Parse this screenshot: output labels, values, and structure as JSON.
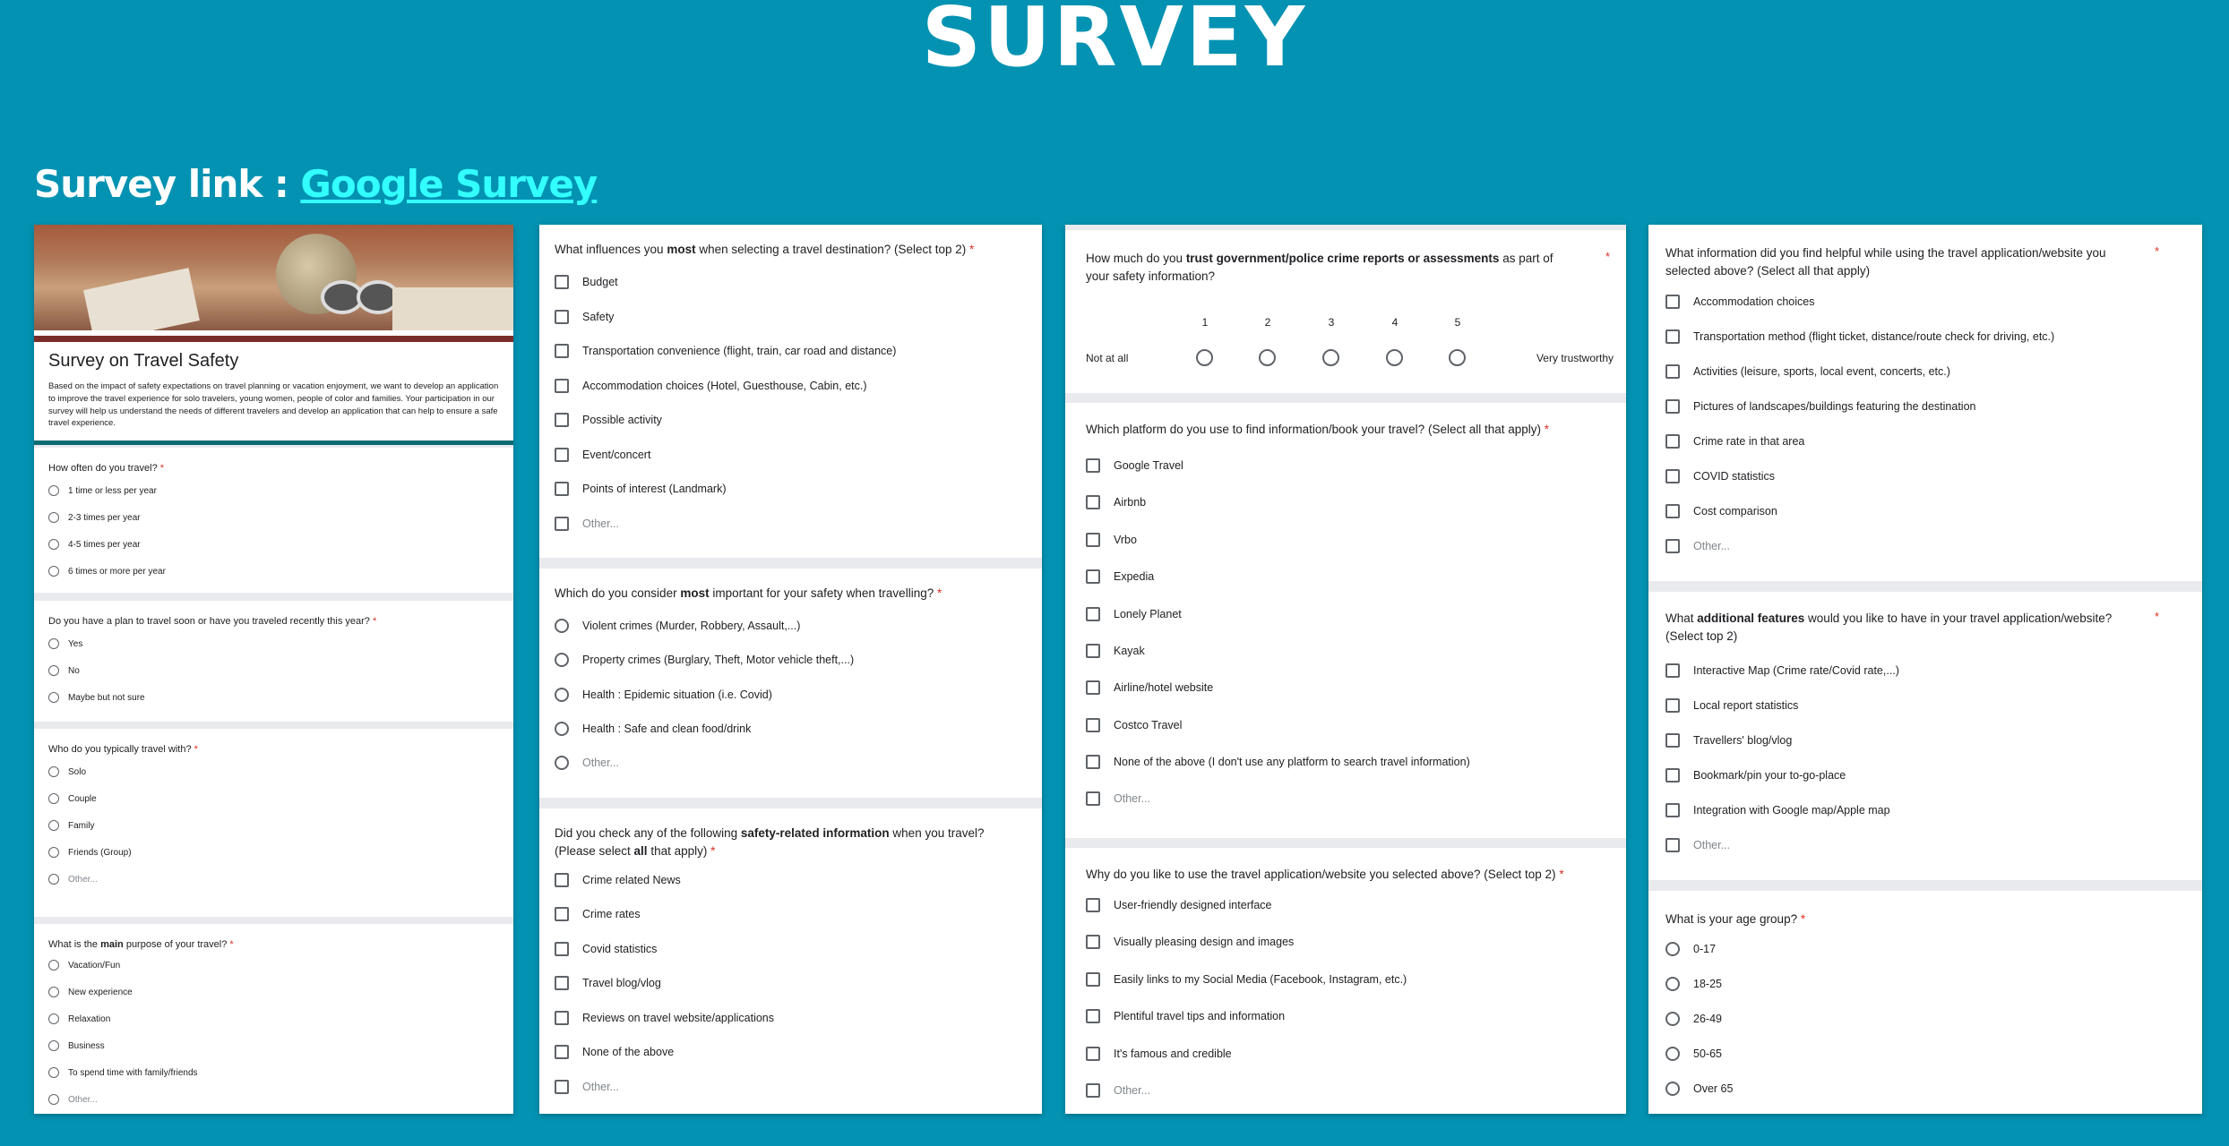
{
  "page": {
    "title": "SURVEY",
    "survey_link_label": "Survey link : ",
    "survey_link_text": "Google Survey"
  },
  "form1": {
    "title": "Survey on Travel Safety",
    "description": "Based on the impact of safety expectations on travel planning or vacation enjoyment, we want to develop an application to improve the travel experience for solo travelers, young women, people of color and families. Your participation in our survey will help us understand the needs of different travelers and develop an application that can help to ensure a safe travel experience.",
    "q_often": {
      "title": "How often do you travel?",
      "options": [
        "1 time or less per year",
        "2-3 times per year",
        "4-5 times per year",
        "6 times or more per year"
      ]
    },
    "q_plan": {
      "title": "Do you have a plan to travel soon or have you traveled recently this year?",
      "options": [
        "Yes",
        "No",
        "Maybe but not sure"
      ]
    },
    "q_who": {
      "title": "Who do you typically travel with?",
      "options": [
        "Solo",
        "Couple",
        "Family",
        "Friends (Group)",
        "Other..."
      ]
    },
    "q_purpose": {
      "title_pre": "What is the ",
      "title_bold": "main",
      "title_post": " purpose of your travel?",
      "options": [
        "Vacation/Fun",
        "New experience",
        "Relaxation",
        "Business",
        "To spend time with family/friends",
        "Other..."
      ]
    }
  },
  "form2": {
    "q_influence": {
      "title_pre": "What influences you ",
      "title_bold": "most",
      "title_post": " when selecting a travel destination? (Select top 2)",
      "options": [
        "Budget",
        "Safety",
        "Transportation convenience (flight, train, car road and distance)",
        "Accommodation choices (Hotel, Guesthouse, Cabin, etc.)",
        "Possible activity",
        "Event/concert",
        "Points of interest (Landmark)",
        "Other..."
      ]
    },
    "q_important": {
      "title_pre": "Which do you consider ",
      "title_bold": "most",
      "title_post": " important for your safety when travelling?",
      "options": [
        "Violent crimes (Murder, Robbery, Assault,...)",
        "Property crimes (Burglary, Theft, Motor vehicle theft,...)",
        "Health : Epidemic situation (i.e. Covid)",
        "Health : Safe and clean food/drink",
        "Other..."
      ]
    },
    "q_check": {
      "title_pre": "Did you check any of the following ",
      "title_bold": "safety-related information",
      "title_mid": " when you travel? (Please select ",
      "title_bold2": "all",
      "title_post": " that apply)",
      "options": [
        "Crime related News",
        "Crime rates",
        "Covid statistics",
        "Travel blog/vlog",
        "Reviews on travel website/applications",
        "None of the above",
        "Other..."
      ]
    }
  },
  "form3": {
    "q_trust": {
      "title_pre": "How much do you ",
      "title_bold": "trust government/police crime reports or assessments",
      "title_post": " as part of your safety information?",
      "scale": [
        "1",
        "2",
        "3",
        "4",
        "5"
      ],
      "low_label": "Not at all",
      "high_label": "Very trustworthy"
    },
    "q_platform": {
      "title": "Which platform do you use to find information/book your travel? (Select all that apply)",
      "options": [
        "Google Travel",
        "Airbnb",
        "Vrbo",
        "Expedia",
        "Lonely Planet",
        "Kayak",
        "Airline/hotel website",
        "Costco Travel",
        "None of the above (I don't use any platform to search travel information)",
        "Other..."
      ]
    },
    "q_why": {
      "title": "Why do you like to use the travel application/website you selected above? (Select top 2)",
      "options": [
        "User-friendly designed interface",
        "Visually pleasing design and images",
        "Easily links to my Social Media (Facebook, Instagram, etc.)",
        "Plentiful travel tips and information",
        "It's famous and credible",
        "Other..."
      ]
    }
  },
  "form4": {
    "q_helpful": {
      "title": "What information did you find helpful while using the travel application/website you selected above? (Select all that apply)",
      "options": [
        "Accommodation choices",
        "Transportation method (flight ticket, distance/route check for driving, etc.)",
        "Activities (leisure, sports, local event, concerts, etc.)",
        "Pictures of landscapes/buildings featuring the destination",
        "Crime rate in that area",
        "COVID statistics",
        "Cost comparison",
        "Other..."
      ]
    },
    "q_features": {
      "title_pre": "What ",
      "title_bold": "additional features",
      "title_post": " would you like to have in your travel application/website? (Select top 2)",
      "options": [
        "Interactive Map (Crime rate/Covid rate,...)",
        "Local report statistics",
        "Travellers' blog/vlog",
        "Bookmark/pin your to-go-place",
        "Integration with Google map/Apple map",
        "Other..."
      ]
    },
    "q_age": {
      "title": "What is your age group?",
      "options": [
        "0-17",
        "18-25",
        "26-49",
        "50-65",
        "Over 65"
      ]
    }
  },
  "required_mark": "*"
}
